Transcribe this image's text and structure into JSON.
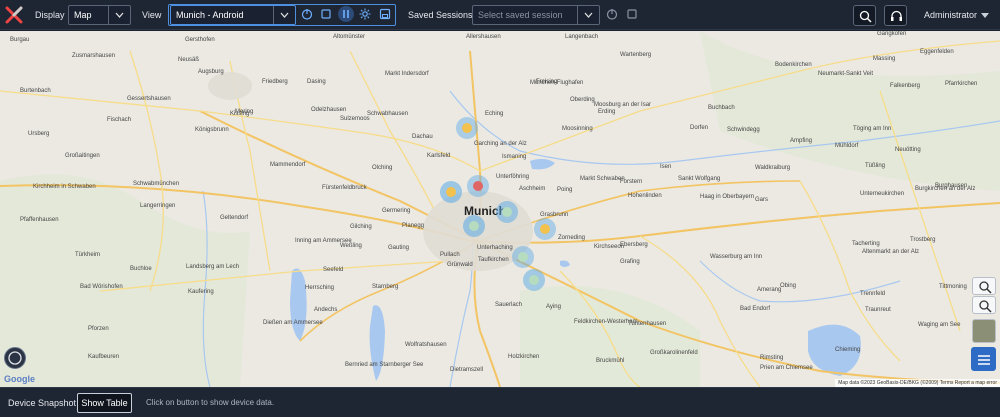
{
  "topbar": {
    "display_label": "Display",
    "display_value": "Map",
    "view_label": "View",
    "view_value": "Munich - Android",
    "saved_sessions_label": "Saved Sessions",
    "saved_sessions_placeholder": "Select saved session",
    "user_label": "Administrator"
  },
  "map": {
    "city_label": "Munich",
    "towns": [
      "Burgau",
      "Gersthofen",
      "Altomünster",
      "Allershausen",
      "Langenbach",
      "Wartenberg",
      "Gangkofen",
      "Zusmarshausen",
      "Neusäß",
      "Augsburg",
      "Friedberg",
      "Dasing",
      "Markt Indersdorf",
      "Freising",
      "München-Flughafen",
      "Moosburg an der Isar",
      "Bodenkirchen",
      "Neumarkt-Sankt Veit",
      "Massing",
      "Eggenfelden",
      "Burtenbach",
      "Gessertshausen",
      "Mering",
      "Odelzhausen",
      "Schwabhausen",
      "Eching",
      "Oberding",
      "Erding",
      "Buchbach",
      "Falkenberg",
      "Pfarrkirchen",
      "Ursberg",
      "Fischach",
      "Königsbrunn",
      "Kissing",
      "Sulzemoos",
      "Dachau",
      "Garching an der Alz",
      "Ismaning",
      "Moosinning",
      "Dorfen",
      "Schwindegg",
      "Ampfing",
      "Mühldorf",
      "Töging am Inn",
      "Neuötting",
      "Großaitingen",
      "Mammendorf",
      "Olching",
      "Karlsfeld",
      "Unterföhring",
      "Aschheim",
      "Markt Schwaben",
      "Forstern",
      "Isen",
      "Sankt Wolfgang",
      "Waldkraiburg",
      "Tüßling",
      "Burghausen",
      "Kirchheim in Schwaben",
      "Schwabmünchen",
      "Fürstenfeldbruck",
      "Germering",
      "Poing",
      "Hohenlinden",
      "Haag in Oberbayern",
      "Gars",
      "Unterneukirchen",
      "Burgkirchen an der Alz",
      "Pfaffenhausen",
      "Langerringen",
      "Geltendorf",
      "Gilching",
      "Planegg",
      "Grasbrunn",
      "Zorneding",
      "Kirchseeon",
      "Ebersberg",
      "Wasserburg am Inn",
      "Trostberg",
      "Tacherting",
      "Altenmarkt an der Alz",
      "Türkheim",
      "Buchloe",
      "Landsberg am Lech",
      "Inning am Ammersee",
      "Weßling",
      "Gauting",
      "Pullach",
      "Grünwald",
      "Unterhaching",
      "Taufkirchen",
      "Grafing",
      "Amerang",
      "Obing",
      "Trennfeld",
      "Bad Wörishofen",
      "Kaufering",
      "Seefeld",
      "Herrsching",
      "Andechs",
      "Starnberg",
      "Sauerlach",
      "Aying",
      "Feldkirchen-Westerham",
      "Tuntenhausen",
      "Bad Endorf",
      "Traunreut",
      "Waging am See",
      "Pforzen",
      "Dießen am Ammersee",
      "Wolfratshausen",
      "Holzkirchen",
      "Bruckmühl",
      "Großkarolinenfeld",
      "Rimsting",
      "Prien am Chiemsee",
      "Chieming",
      "Kaufbeuren",
      "Bernried am Starnberger See",
      "Dietramszell",
      "Tittmoning"
    ]
  },
  "map_controls": {
    "attribution": "Map data ©2023 GeoBasis-DE/BKG (©2009)   Terms   Report a map error",
    "google_logo": "Google"
  },
  "bottombar": {
    "snapshot_label": "Device Snapshot",
    "show_table_label": "Show Table",
    "hint": "Click on button to show device data."
  },
  "colors": {
    "header_bg": "#1f2633",
    "accent_border": "#4d8fe0",
    "cluster_blue": "#5aa9e6",
    "cluster_core_yellow": "#f2c14e",
    "cluster_core_red": "#e06666",
    "river": "#a8c8f0"
  }
}
